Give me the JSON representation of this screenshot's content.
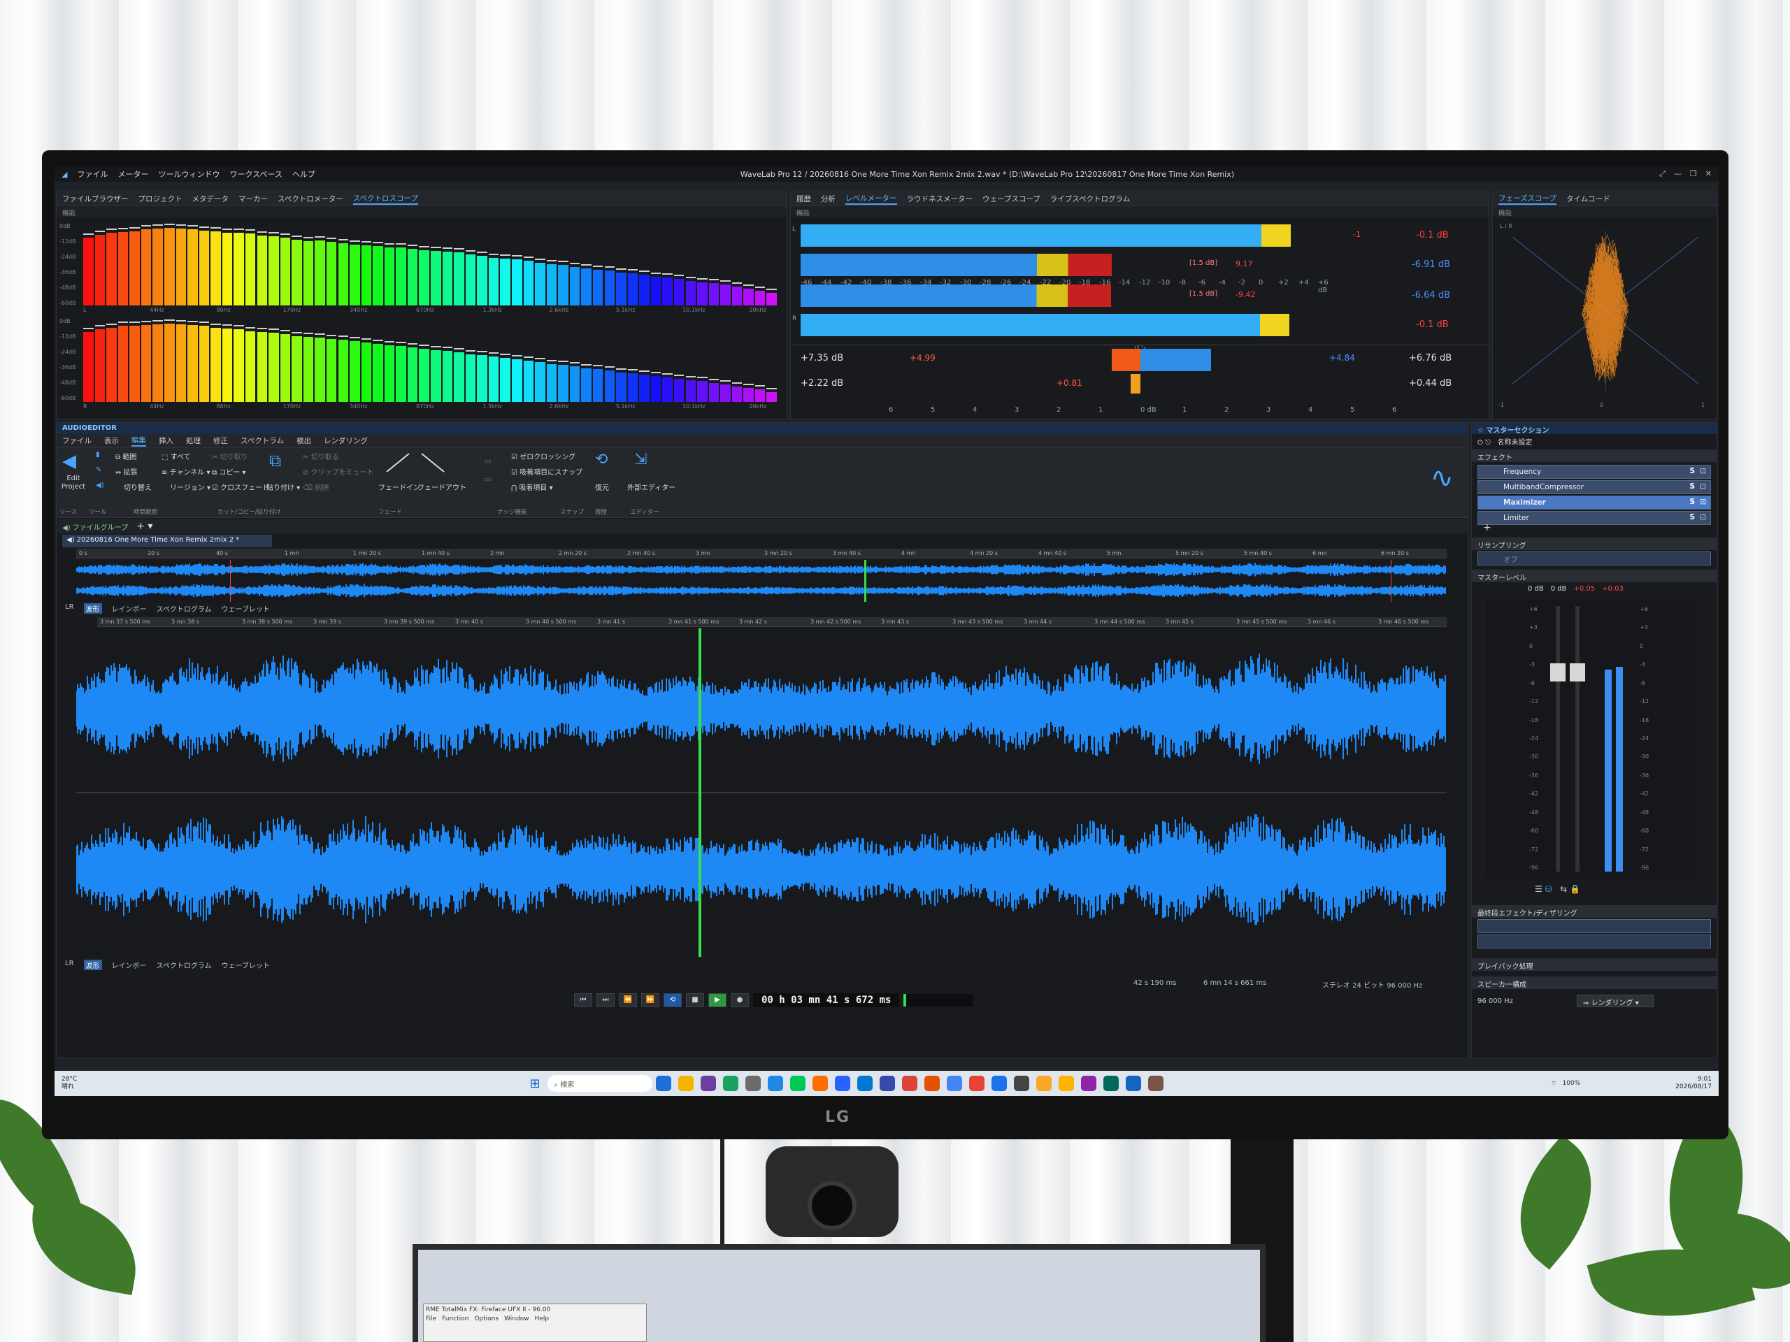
{
  "app": {
    "title": "WaveLab Pro 12 / 20260816 One More Time Xon Remix 2mix 2.wav * (D:\\WaveLab Pro 12\\20260817 One More Time Xon Remix)",
    "menu": [
      "ファイル",
      "メーター",
      "ツールウィンドウ",
      "ワークスペース",
      "ヘルプ"
    ],
    "window_buttons": [
      "⤢",
      "—",
      "❐",
      "✕"
    ]
  },
  "top_left_panel": {
    "side_label": "スペクトロスコープ",
    "tabs": [
      "ファイルブラウザー",
      "プロジェクト",
      "メタデータ",
      "マーカー",
      "スペクトロメーター",
      "スペクトロスコープ"
    ],
    "active_tab": "スペクトロスコープ",
    "sub_label": "機能",
    "db_scale_top": [
      "0dB",
      "-12dB",
      "-24dB",
      "-36dB",
      "-48dB",
      "-60dB"
    ],
    "db_scale_bottom": [
      "0dB",
      "-12dB",
      "-24dB",
      "-36dB",
      "-48dB",
      "-60dB"
    ],
    "freq_labels": [
      "L",
      "44Hz",
      "86Hz",
      "170Hz",
      "340Hz",
      "670Hz",
      "1.3kHz",
      "2.6kHz",
      "5.1kHz",
      "10.1kHz",
      "20kHz"
    ],
    "freq_labels_bottom": [
      "R",
      "44Hz",
      "86Hz",
      "170Hz",
      "340Hz",
      "670Hz",
      "1.3kHz",
      "2.6kHz",
      "5.1kHz",
      "10.1kHz",
      "20kHz"
    ],
    "spectrum_top": [
      0.82,
      0.86,
      0.88,
      0.89,
      0.9,
      0.92,
      0.93,
      0.94,
      0.93,
      0.92,
      0.91,
      0.9,
      0.88,
      0.88,
      0.87,
      0.85,
      0.84,
      0.82,
      0.8,
      0.78,
      0.79,
      0.77,
      0.75,
      0.74,
      0.73,
      0.72,
      0.7,
      0.7,
      0.69,
      0.67,
      0.66,
      0.65,
      0.64,
      0.62,
      0.6,
      0.58,
      0.57,
      0.56,
      0.54,
      0.52,
      0.5,
      0.49,
      0.47,
      0.45,
      0.43,
      0.42,
      0.4,
      0.39,
      0.37,
      0.35,
      0.34,
      0.32,
      0.3,
      0.28,
      0.27,
      0.25,
      0.23,
      0.2,
      0.18,
      0.15
    ],
    "spectrum_bottom": [
      0.85,
      0.88,
      0.9,
      0.92,
      0.92,
      0.93,
      0.94,
      0.95,
      0.94,
      0.93,
      0.92,
      0.9,
      0.89,
      0.88,
      0.86,
      0.85,
      0.84,
      0.82,
      0.8,
      0.79,
      0.78,
      0.76,
      0.75,
      0.74,
      0.72,
      0.7,
      0.69,
      0.68,
      0.66,
      0.64,
      0.63,
      0.62,
      0.6,
      0.58,
      0.57,
      0.55,
      0.53,
      0.52,
      0.5,
      0.48,
      0.46,
      0.45,
      0.43,
      0.41,
      0.4,
      0.38,
      0.36,
      0.35,
      0.33,
      0.31,
      0.3,
      0.28,
      0.26,
      0.25,
      0.23,
      0.21,
      0.19,
      0.17,
      0.15,
      0.12
    ]
  },
  "level_meter_panel": {
    "tabs": [
      "履歴",
      "分析",
      "レベルメーター",
      "ラウドネスメーター",
      "ウェーブスコープ",
      "ライブスペクトログラム"
    ],
    "active_tab": "レベルメーター",
    "sub_label": "機能",
    "channels": [
      {
        "label": "L",
        "peak_level": 0.947,
        "peak_label": "-1",
        "peak_db": "-0.1 dB",
        "rms_level": 0.602,
        "rms_box": "[1.5 dB]",
        "rms_value": "9.17",
        "rms_db": "-6.91 dB"
      },
      {
        "label": "R",
        "peak_level": 0.945,
        "peak_label": "",
        "peak_db": "-0.1 dB",
        "rms_level": 0.6,
        "rms_box": "[1.5 dB]",
        "rms_value": "-9.42",
        "rms_db": "-6.64 dB"
      }
    ],
    "scale": [
      "-46",
      "-44",
      "-42",
      "-40",
      "-38",
      "-36",
      "-34",
      "-32",
      "-30",
      "-28",
      "-26",
      "-24",
      "-22",
      "-20",
      "-18",
      "-16",
      "-14",
      "-12",
      "-10",
      "-8",
      "-6",
      "-4",
      "-2",
      "0",
      "+2",
      "+4",
      "+6 dB"
    ],
    "pan_label": "パン",
    "pan_rows": [
      {
        "left_db": "+7.35 dB",
        "left_mark": "+4.99",
        "right_mark": "+4.84",
        "right_db": "+6.76 dB",
        "left_fill": 0.09,
        "right_fill": 0.22
      },
      {
        "left_db": "+2.22 dB",
        "left_mark": "+0.81",
        "right_db": "+0.44 dB",
        "left_fill": 0.03,
        "right_fill": 0
      }
    ],
    "pan_scale": [
      "6",
      "5",
      "4",
      "3",
      "2",
      "1",
      "0 dB",
      "1",
      "2",
      "3",
      "4",
      "5",
      "6"
    ]
  },
  "phase_scope": {
    "tabs": [
      "フェーズスコープ",
      "タイムコード"
    ],
    "active_tab": "フェーズスコープ",
    "sub_label": "機能",
    "corner_label": "L / R",
    "scale": [
      "-1",
      "0",
      "1"
    ]
  },
  "audio_editor": {
    "title": "AUDIOEDITOR",
    "ribbon_tabs": [
      "ファイル",
      "表示",
      "編集",
      "挿入",
      "処理",
      "修正",
      "スペクトラム",
      "検出",
      "レンダリング"
    ],
    "active_ribbon_tab": "編集",
    "edit_project": "Edit Project",
    "items": {
      "range": "範囲",
      "all": "すべて",
      "cut": "切り取り",
      "cut2": "切り取る",
      "extend": "拡張",
      "channel": "チャンネル",
      "copy": "コピー",
      "clip_mute": "クリップをミュート",
      "toggle": "切り替え",
      "region": "リージョン",
      "crossfade": "クロスフェード",
      "paste": "貼り付け",
      "delete": "削除",
      "fade_in": "フェードイン",
      "fade_out": "フェードアウト",
      "zero_cross": "ゼロクロッシング",
      "snap_items": "吸着項目にスナップ",
      "snap_item": "吸着項目",
      "restore": "復元",
      "external_editor": "外部エディター"
    },
    "groups": [
      "ソース",
      "ツール",
      "時間範囲",
      "カット/コピー/貼り付け",
      "フェード",
      "ナッジ機能",
      "スナップ",
      "履歴",
      "エディター"
    ],
    "file_group_tab": "ファイルグループ",
    "file_tab": "20260816 One More Time Xon Remix 2mix 2 *",
    "overview_ruler": [
      "0 s",
      "20 s",
      "40 s",
      "1 mn",
      "1 mn 20 s",
      "1 mn 40 s",
      "2 mn",
      "2 mn 20 s",
      "2 mn 40 s",
      "3 mn",
      "3 mn 20 s",
      "3 mn 40 s",
      "4 mn",
      "4 mn 20 s",
      "4 mn 40 s",
      "5 mn",
      "5 mn 20 s",
      "5 mn 40 s",
      "6 mn",
      "6 mn 20 s"
    ],
    "main_ruler": [
      "3 mn 37 s 500 ms",
      "3 mn 38 s",
      "3 mn 38 s 500 ms",
      "3 mn 39 s",
      "3 mn 39 s 500 ms",
      "3 mn 40 s",
      "3 mn 40 s 500 ms",
      "3 mn 41 s",
      "3 mn 41 s 500 ms",
      "3 mn 42 s",
      "3 mn 42 s 500 ms",
      "3 mn 43 s",
      "3 mn 43 s 500 ms",
      "3 mn 44 s",
      "3 mn 44 s 500 ms",
      "3 mn 45 s",
      "3 mn 45 s 500 ms",
      "3 mn 46 s",
      "3 mn 46 s 500 ms"
    ],
    "view_tabs": [
      "LR",
      "波形",
      "レインボー",
      "スペクトログラム",
      "ウェーブレット"
    ],
    "active_view": "波形",
    "overview_cursor": 0.575,
    "main_cursor": 0.454,
    "transport_buttons": [
      "⏮",
      "⏭",
      "⏪",
      "⏩",
      "⟲",
      "■",
      "▶",
      "●"
    ],
    "timecode": "00 h 03 mn 41 s 672 ms",
    "status": {
      "selection": "42 s 190 ms",
      "length": "6 mn 14 s 661 ms",
      "format": "ステレオ 24 ビット 96 000 Hz"
    }
  },
  "master_section": {
    "title": "マスターセクション",
    "preset": "名称未設定",
    "effects_label": "エフェクト",
    "effects": [
      {
        "name": "Frequency",
        "selected": false
      },
      {
        "name": "MultibandCompressor",
        "selected": false
      },
      {
        "name": "Maximizer",
        "selected": true
      },
      {
        "name": "Limiter",
        "selected": false
      }
    ],
    "slot_s": "S",
    "add_slot": "+",
    "resampling_label": "リサンプリング",
    "resampling_value": "オフ",
    "master_level_label": "マスターレベル",
    "level_readout": [
      "0 dB",
      "0 dB",
      "+0.05",
      "+0.03"
    ],
    "fader_scale": [
      "+6",
      "+3",
      "0",
      "-3",
      "-6",
      "-12",
      "-18",
      "-24",
      "-30",
      "-36",
      "-42",
      "-48",
      "-60",
      "-72",
      "-96"
    ],
    "meter_levels": [
      0.76,
      0.77
    ],
    "final_effects_label": "最終段エフェクト/ディザリング",
    "playback_label": "プレイバック処理",
    "speaker_label": "スピーカー構成",
    "sample_rate": "96 000 Hz",
    "render_button": "レンダリング"
  },
  "taskbar": {
    "weather_temp": "28°C",
    "weather_text": "晴れ",
    "search_placeholder": "検索",
    "time": "9:01",
    "date": "2026/08/17",
    "battery": "100%",
    "icon_colors": [
      "#1e6fd9",
      "#f4b400",
      "#6b3fa0",
      "#1aa260",
      "#6b6b6b",
      "#1e88e5",
      "#00c853",
      "#ff6d00",
      "#2962ff",
      "#0078d4",
      "#3949ab",
      "#db4437",
      "#e65100",
      "#4285f4",
      "#ea4335",
      "#1a73e8",
      "#444444",
      "#f9a825",
      "#ffb300",
      "#8e24aa",
      "#00695c",
      "#1565c0",
      "#795548"
    ]
  },
  "laptop_window": {
    "title": "RME TotalMix FX: Fireface UFX II - 96.00",
    "menu": [
      "File",
      "Function",
      "Options",
      "Window",
      "Help"
    ]
  }
}
